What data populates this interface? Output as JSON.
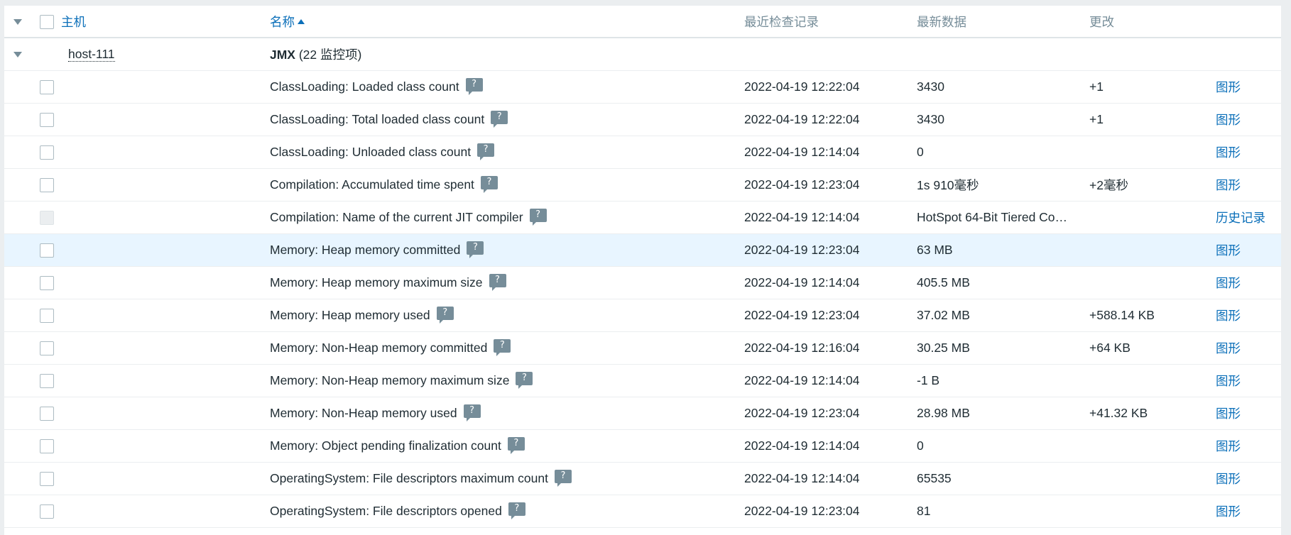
{
  "header": {
    "host": "主机",
    "name": "名称",
    "last_check": "最近检查记录",
    "latest_data": "最新数据",
    "change": "更改"
  },
  "group": {
    "host": "host-111",
    "app_name": "JMX",
    "app_count": " (22 监控项)"
  },
  "rows": [
    {
      "name": "ClassLoading: Loaded class count",
      "last_check": "2022-04-19 12:22:04",
      "latest": "3430",
      "change": "+1",
      "action": "图形"
    },
    {
      "name": "ClassLoading: Total loaded class count",
      "last_check": "2022-04-19 12:22:04",
      "latest": "3430",
      "change": "+1",
      "action": "图形"
    },
    {
      "name": "ClassLoading: Unloaded class count",
      "last_check": "2022-04-19 12:14:04",
      "latest": "0",
      "change": "",
      "action": "图形"
    },
    {
      "name": "Compilation: Accumulated time spent",
      "last_check": "2022-04-19 12:23:04",
      "latest": "1s 910毫秒",
      "change": "+2毫秒",
      "action": "图形"
    },
    {
      "name": "Compilation: Name of the current JIT compiler",
      "last_check": "2022-04-19 12:14:04",
      "latest": "HotSpot 64-Bit Tiered Co…",
      "change": "",
      "action": "历史记录"
    },
    {
      "name": "Memory: Heap memory committed",
      "last_check": "2022-04-19 12:23:04",
      "latest": "63 MB",
      "change": "",
      "action": "图形"
    },
    {
      "name": "Memory: Heap memory maximum size",
      "last_check": "2022-04-19 12:14:04",
      "latest": "405.5 MB",
      "change": "",
      "action": "图形"
    },
    {
      "name": "Memory: Heap memory used",
      "last_check": "2022-04-19 12:23:04",
      "latest": "37.02 MB",
      "change": "+588.14 KB",
      "action": "图形"
    },
    {
      "name": "Memory: Non-Heap memory committed",
      "last_check": "2022-04-19 12:16:04",
      "latest": "30.25 MB",
      "change": "+64 KB",
      "action": "图形"
    },
    {
      "name": "Memory: Non-Heap memory maximum size",
      "last_check": "2022-04-19 12:14:04",
      "latest": "-1 B",
      "change": "",
      "action": "图形"
    },
    {
      "name": "Memory: Non-Heap memory used",
      "last_check": "2022-04-19 12:23:04",
      "latest": "28.98 MB",
      "change": "+41.32 KB",
      "action": "图形"
    },
    {
      "name": "Memory: Object pending finalization count",
      "last_check": "2022-04-19 12:14:04",
      "latest": "0",
      "change": "",
      "action": "图形"
    },
    {
      "name": "OperatingSystem: File descriptors maximum count",
      "last_check": "2022-04-19 12:14:04",
      "latest": "65535",
      "change": "",
      "action": "图形"
    },
    {
      "name": "OperatingSystem: File descriptors opened",
      "last_check": "2022-04-19 12:23:04",
      "latest": "81",
      "change": "",
      "action": "图形"
    }
  ],
  "help_glyph": "?",
  "icons": {
    "collapse": "triangle-down-icon",
    "sort": "sort-ascending-icon",
    "help": "help-tooltip-icon"
  },
  "colors": {
    "link": "#0b6fb9",
    "header_muted": "#768d99",
    "row_highlight": "#e8f5ff",
    "help_icon_bg": "#768d99"
  }
}
